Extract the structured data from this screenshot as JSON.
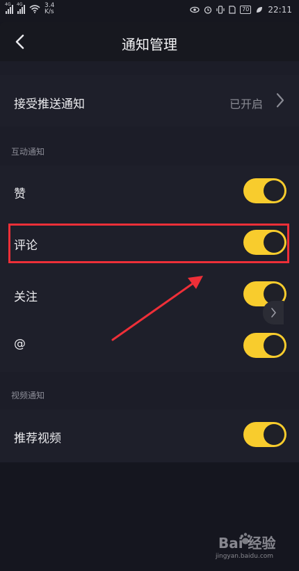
{
  "status_bar": {
    "network_1": "4G",
    "network_2": "4G",
    "speed_value": "3.4",
    "speed_unit": "K/s",
    "battery": "70",
    "time": "22:11"
  },
  "header": {
    "title": "通知管理"
  },
  "push": {
    "label": "接受推送通知",
    "value": "已开启"
  },
  "interactive_section": {
    "label": "互动通知",
    "items": [
      {
        "label": "赞",
        "enabled": true
      },
      {
        "label": "评论",
        "enabled": true
      },
      {
        "label": "关注",
        "enabled": true
      },
      {
        "label": "@",
        "enabled": true
      }
    ]
  },
  "video_section": {
    "label": "视频通知",
    "items": [
      {
        "label": "推荐视频",
        "enabled": true
      }
    ]
  },
  "watermark": {
    "brand": "Bai 经验",
    "url": "jingyan.baidu.com"
  },
  "colors": {
    "toggle_on": "#f8cc2d",
    "highlight": "#ee2f38",
    "background": "#15161f"
  }
}
